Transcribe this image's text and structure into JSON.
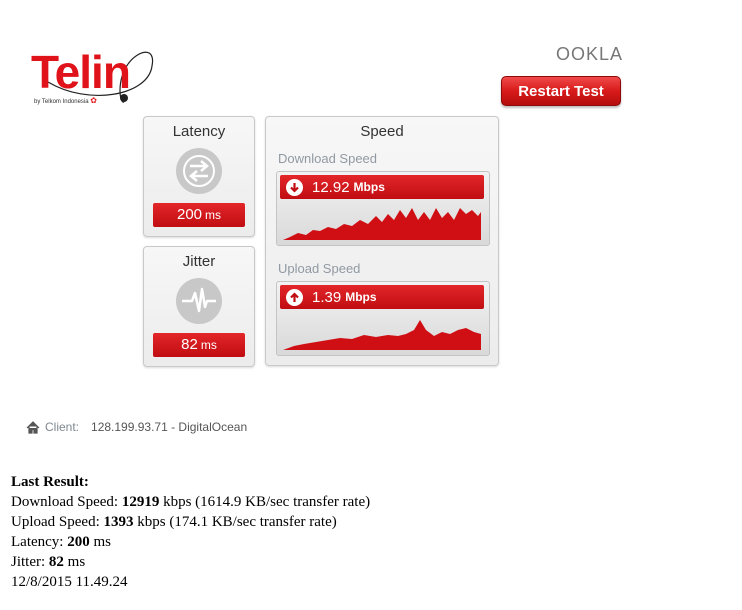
{
  "brand": {
    "logo_text": "Telin",
    "logo_tagline": "by Telkom Indonesia",
    "provider": "OOKLA"
  },
  "toolbar": {
    "restart_label": "Restart Test"
  },
  "latency": {
    "title": "Latency",
    "value": "200",
    "unit": "ms"
  },
  "jitter": {
    "title": "Jitter",
    "value": "82",
    "unit": "ms"
  },
  "speed": {
    "title": "Speed",
    "download": {
      "label": "Download Speed",
      "value": "12.92",
      "unit": "Mbps"
    },
    "upload": {
      "label": "Upload Speed",
      "value": "1.39",
      "unit": "Mbps"
    }
  },
  "client": {
    "label": "Client:",
    "value": "128.199.93.71 - DigitalOcean"
  },
  "last_result": {
    "heading": "Last Result:",
    "download_prefix": "Download Speed: ",
    "download_value": "12919",
    "download_suffix": " kbps (1614.9 KB/sec transfer rate)",
    "upload_prefix": "Upload Speed: ",
    "upload_value": "1393",
    "upload_suffix": " kbps (174.1 KB/sec transfer rate)",
    "latency_prefix": "Latency: ",
    "latency_value": "200",
    "latency_suffix": " ms",
    "jitter_prefix": "Jitter: ",
    "jitter_value": "82",
    "jitter_suffix": " ms",
    "timestamp": "12/8/2015 11.49.24"
  },
  "colors": {
    "accent": "#e1131a",
    "panel": "#eeeeee"
  }
}
